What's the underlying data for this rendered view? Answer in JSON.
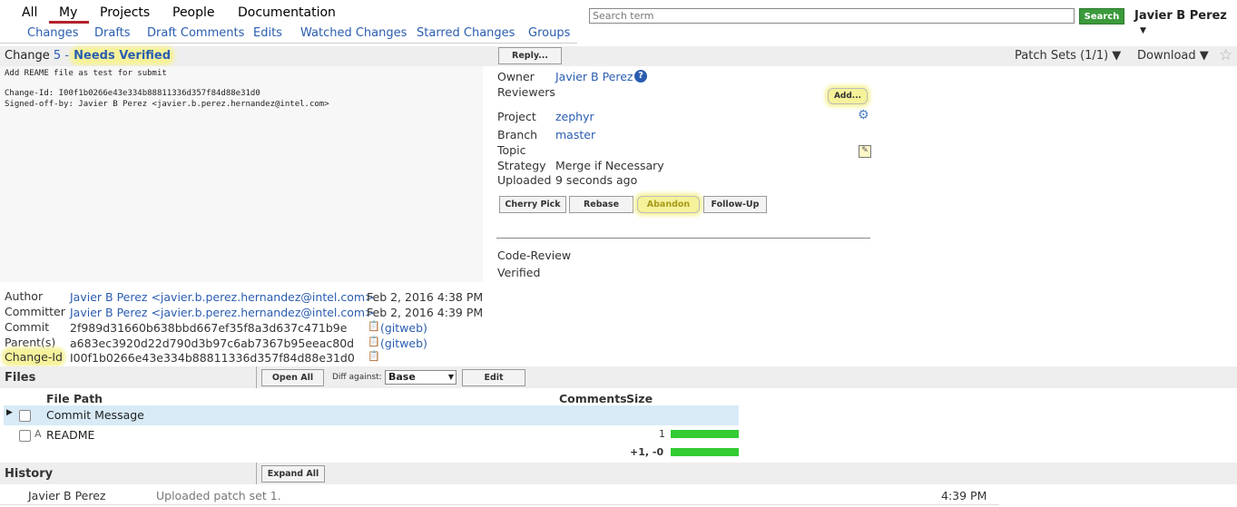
{
  "topnav": {
    "items": [
      "All",
      "My",
      "Projects",
      "People",
      "Documentation"
    ],
    "active": "My"
  },
  "subnav": {
    "items": [
      "Changes",
      "Drafts",
      "Draft Comments",
      "Edits",
      "Watched Changes",
      "Starred Changes",
      "Groups"
    ]
  },
  "search": {
    "placeholder": "Search term",
    "button": "Search"
  },
  "user": {
    "name": "Javier B Perez",
    "menu_icon": "triangle-down-icon"
  },
  "change": {
    "prefix": "Change ",
    "number": "5",
    "separator": " - ",
    "status": "Needs Verified",
    "reply_label": "Reply...",
    "patch_sets_label": "Patch Sets (1/1) ▼",
    "download_label": "Download ▼"
  },
  "commit_message": {
    "subject": "Add REAME file as test for submit",
    "change_id_line": "Change-Id: I00f1b0266e43e334b88811336d357f84d88e31d0",
    "signed_off_line": "Signed-off-by: Javier B Perez <javier.b.perez.hernandez@intel.com>"
  },
  "meta": {
    "owner_label": "Owner",
    "owner": "Javier B Perez",
    "reviewers_label": "Reviewers",
    "add_label": "Add...",
    "project_label": "Project",
    "project": "zephyr",
    "branch_label": "Branch",
    "branch": "master",
    "topic_label": "Topic",
    "strategy_label": "Strategy",
    "strategy": "Merge if Necessary",
    "uploaded_label": "Uploaded",
    "uploaded": "9 seconds ago"
  },
  "actions": [
    "Cherry Pick",
    "Rebase",
    "Abandon",
    "Follow-Up"
  ],
  "labels": [
    "Code-Review",
    "Verified"
  ],
  "commit_info": {
    "author_label": "Author",
    "author": "Javier B Perez <javier.b.perez.hernandez@intel.com>",
    "author_date": "Feb 2, 2016 4:38 PM",
    "committer_label": "Committer",
    "committer": "Javier B Perez <javier.b.perez.hernandez@intel.com>",
    "committer_date": "Feb 2, 2016 4:39 PM",
    "commit_label": "Commit",
    "commit": "2f989d31660b638bbd667ef35f8a3d637c471b9e",
    "parent_label": "Parent(s)",
    "parent": "a683ec3920d22d790d3b97c6ab7367b95eeac80d",
    "changeid_label": "Change-Id",
    "changeid": "I00f1b0266e43e334b88811336d357f84d88e31d0",
    "gitweb": "(gitweb)"
  },
  "files": {
    "title": "Files",
    "open_all": "Open All",
    "diff_against_label": "Diff against:",
    "diff_against_value": "Base",
    "edit_label": "Edit",
    "headers": {
      "path": "File Path",
      "comments": "Comments",
      "size": "Size"
    },
    "rows": [
      {
        "status": "",
        "path": "Commit Message",
        "size": ""
      },
      {
        "status": "A",
        "path": "README",
        "size": "1"
      }
    ],
    "total": "+1, -0"
  },
  "history": {
    "title": "History",
    "expand_all": "Expand All",
    "entries": [
      {
        "author": "Javier B Perez",
        "message": "Uploaded patch set 1.",
        "time": "4:39 PM"
      }
    ]
  },
  "colors": {
    "accent": "#b5222c",
    "link": "#2a5db0",
    "highlight": "#f6f29a",
    "search_button": "#3b9a3b",
    "size_bar": "#33cc33"
  }
}
